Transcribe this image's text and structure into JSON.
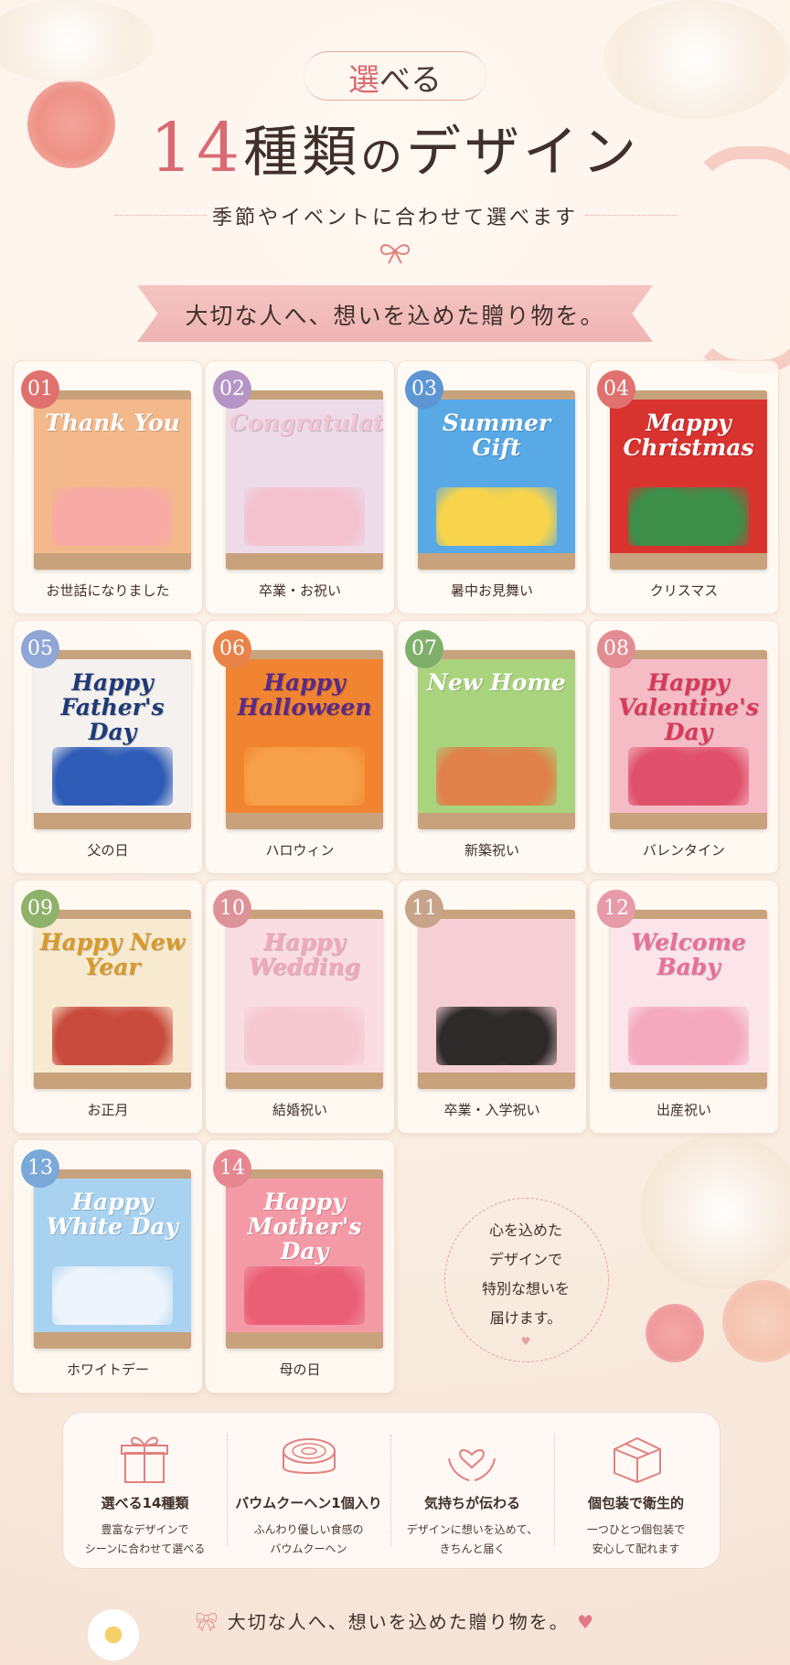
{
  "header": {
    "pill_accent": "選",
    "pill_rest": "べる",
    "title_num": "14",
    "title_main": "種類",
    "title_no": "の",
    "title_rest": "デザイン",
    "subtitle": "季節やイベントに合わせて選べます",
    "banner": "大切な人へ、想いを込めた贈り物を。"
  },
  "designs": [
    {
      "num": "01",
      "label": "お世話になりました",
      "wrap_title": "Thank You",
      "badge_color": "#e0716f",
      "wrap_color": "#f3b98c",
      "title_color": "#ffffff",
      "deco_color": "#f6a9a5"
    },
    {
      "num": "02",
      "label": "卒業・お祝い",
      "wrap_title": "Congratulations",
      "badge_color": "#b495c6",
      "wrap_color": "#eedbe8",
      "title_color": "#f2c5d4",
      "deco_color": "#f3c1cf"
    },
    {
      "num": "03",
      "label": "暑中お見舞い",
      "wrap_title": "Summer Gift",
      "badge_color": "#5d96d3",
      "wrap_color": "#59a9e6",
      "title_color": "#ffffff",
      "deco_color": "#f7d44b"
    },
    {
      "num": "04",
      "label": "クリスマス",
      "wrap_title": "Mappy Christmas",
      "badge_color": "#e0716f",
      "wrap_color": "#d8332f",
      "title_color": "#ffffff",
      "deco_color": "#3d8f4a"
    },
    {
      "num": "05",
      "label": "父の日",
      "wrap_title": "Happy Father's Day",
      "badge_color": "#8fa6d6",
      "wrap_color": "#f4f1ee",
      "title_color": "#1e3a78",
      "deco_color": "#2d5bb6"
    },
    {
      "num": "06",
      "label": "ハロウィン",
      "wrap_title": "Happy Halloween",
      "badge_color": "#e9834a",
      "wrap_color": "#f08431",
      "title_color": "#5a2a86",
      "deco_color": "#f7a04a"
    },
    {
      "num": "07",
      "label": "新築祝い",
      "wrap_title": "New Home",
      "badge_color": "#7fb06b",
      "wrap_color": "#a9d47d",
      "title_color": "#ffffff",
      "deco_color": "#e0804a"
    },
    {
      "num": "08",
      "label": "バレンタイン",
      "wrap_title": "Happy Valentine's Day",
      "badge_color": "#e38c94",
      "wrap_color": "#f6bcc6",
      "title_color": "#d83a5a",
      "deco_color": "#e0506c"
    },
    {
      "num": "09",
      "label": "お正月",
      "wrap_title": "Happy New Year",
      "badge_color": "#8fb26a",
      "wrap_color": "#f8ead0",
      "title_color": "#d79a2b",
      "deco_color": "#c84b3d"
    },
    {
      "num": "10",
      "label": "結婚祝い",
      "wrap_title": "Happy Wedding",
      "badge_color": "#dd9298",
      "wrap_color": "#f9dde2",
      "title_color": "#f0a8bb",
      "deco_color": "#f5c8d2"
    },
    {
      "num": "11",
      "label": "卒業・入学祝い",
      "wrap_title": "",
      "badge_color": "#c7a38a",
      "wrap_color": "#f6cfd6",
      "title_color": "#e88aa0",
      "deco_color": "#2e2a2a"
    },
    {
      "num": "12",
      "label": "出産祝い",
      "wrap_title": "Welcome Baby",
      "badge_color": "#e79aa8",
      "wrap_color": "#fbe4ea",
      "title_color": "#e86f96",
      "deco_color": "#f4a9c0"
    },
    {
      "num": "13",
      "label": "ホワイトデー",
      "wrap_title": "Happy White Day",
      "badge_color": "#7aa8d8",
      "wrap_color": "#a9d2f1",
      "title_color": "#ffffff",
      "deco_color": "#eef4fb"
    },
    {
      "num": "14",
      "label": "母の日",
      "wrap_title": "Happy Mother's Day",
      "badge_color": "#e68790",
      "wrap_color": "#f49aa6",
      "title_color": "#ffffff",
      "deco_color": "#ea5f77"
    }
  ],
  "circle": {
    "line1": "心を込めた",
    "line2": "デザインで",
    "line3": "特別な想いを",
    "line4": "届けます。"
  },
  "features": [
    {
      "icon": "gift-icon",
      "title": "選べる14種類",
      "desc1": "豊富なデザインで",
      "desc2": "シーンに合わせて選べる"
    },
    {
      "icon": "baumkuchen-icon",
      "title": "バウムクーヘン1個入り",
      "desc1": "ふんわり優しい食感の",
      "desc2": "バウムクーヘン"
    },
    {
      "icon": "heart-hands-icon",
      "title": "気持ちが伝わる",
      "desc1": "デザインに想いを込めて、",
      "desc2": "きちんと届く"
    },
    {
      "icon": "package-icon",
      "title": "個包装で衛生的",
      "desc1": "一つひとつ個包装で",
      "desc2": "安心して配れます"
    }
  ],
  "footer": "大切な人へ、想いを込めた贈り物を。",
  "colors": {
    "accent": "#d96a74",
    "line": "#e5a8a6",
    "text": "#3f302a"
  }
}
